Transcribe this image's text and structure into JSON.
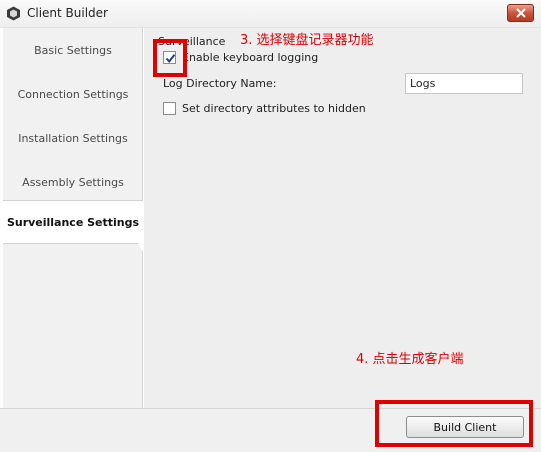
{
  "window": {
    "title": "Client Builder",
    "close_glyph": "✕"
  },
  "sidebar": {
    "items": [
      {
        "label": "Basic Settings"
      },
      {
        "label": "Connection Settings"
      },
      {
        "label": "Installation Settings"
      },
      {
        "label": "Assembly Settings"
      },
      {
        "label": "Surveillance Settings",
        "active": true
      }
    ]
  },
  "main": {
    "group_title": "Surveillance",
    "enable_logging": {
      "label": "Enable keyboard logging",
      "checked": true
    },
    "log_dir": {
      "label": "Log Directory Name:",
      "value": "Logs"
    },
    "hidden_attrs": {
      "label": "Set directory attributes to hidden",
      "checked": false
    }
  },
  "footer": {
    "build_label": "Build Client"
  },
  "annotations": {
    "step3": "3. 选择键盘记录器功能",
    "step4": "4. 点击生成客户端"
  },
  "colors": {
    "annotation": "#e00000",
    "close_button": "#c75139"
  }
}
